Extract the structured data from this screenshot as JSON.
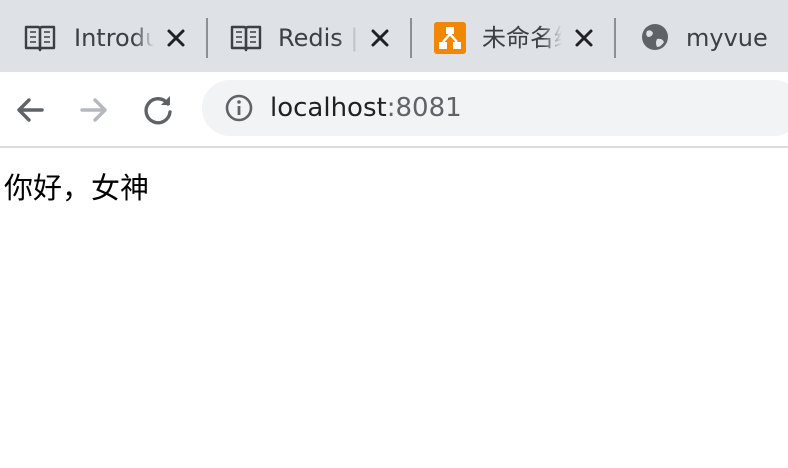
{
  "tabs": [
    {
      "title": "Introduction",
      "icon": "book-icon"
    },
    {
      "title": "Redis | The Real-time Data Platform",
      "icon": "book-icon"
    },
    {
      "title": "未命名绘图",
      "icon": "drawio-icon",
      "accent": "#f08705"
    },
    {
      "title": "myvue",
      "icon": "globe-icon"
    }
  ],
  "address_bar": {
    "host": "localhost",
    "port": ":8081"
  },
  "page": {
    "text": "你好，女神"
  },
  "colors": {
    "tabstrip": "#dee1e6",
    "omnibox": "#f1f3f4",
    "icon": "#5f6368",
    "disabled_icon": "#b5b8bc"
  }
}
